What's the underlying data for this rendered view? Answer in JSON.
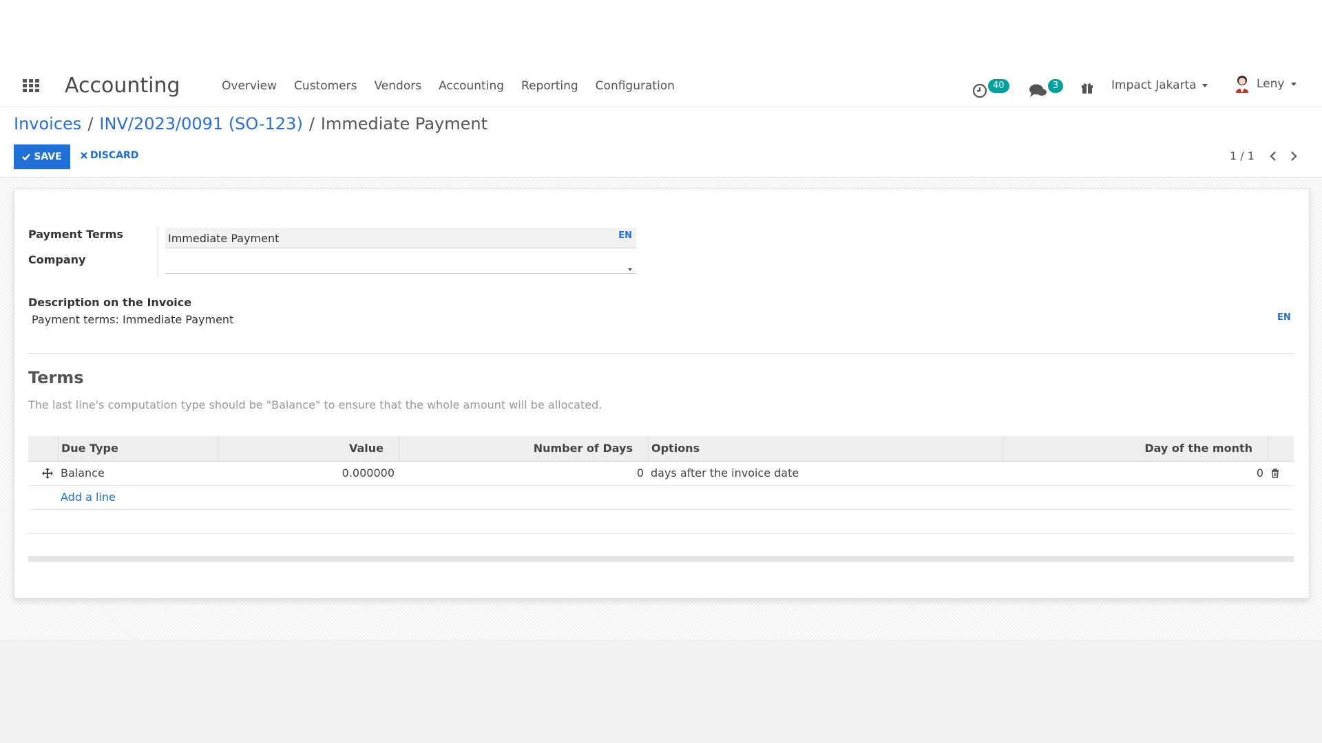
{
  "navbar": {
    "app_name": "Accounting",
    "menu": [
      "Overview",
      "Customers",
      "Vendors",
      "Accounting",
      "Reporting",
      "Configuration"
    ],
    "activity_count": "40",
    "message_count": "3",
    "company": "Impact Jakarta",
    "user": "Leny",
    "icons": [
      "apps-grid-icon",
      "clock-icon",
      "chat-icon",
      "gift-icon",
      "user-avatar-icon"
    ]
  },
  "breadcrumb": {
    "item1": "Invoices",
    "sep": "/",
    "item2": "INV/2023/0091 (SO-123)",
    "current": "Immediate Payment"
  },
  "actions": {
    "save": "SAVE",
    "discard": "DISCARD"
  },
  "pager": {
    "value": "1 / 1"
  },
  "form": {
    "payment_terms_label": "Payment Terms",
    "payment_terms_value": "Immediate Payment",
    "company_label": "Company",
    "company_value": "",
    "lang_tag": "EN",
    "description_label": "Description on the Invoice",
    "description_value": "Payment terms: Immediate Payment"
  },
  "terms": {
    "title": "Terms",
    "help": "The last line's computation type should be \"Balance\" to ensure that the whole amount will be allocated.",
    "columns": [
      "Due Type",
      "Value",
      "Number of Days",
      "Options",
      "Day of the month"
    ],
    "rows": [
      {
        "due_type": "Balance",
        "value": "0.000000",
        "days": "0",
        "options": "days after the invoice date",
        "day_of_month": "0"
      }
    ],
    "add_line": "Add a line"
  },
  "colors": {
    "accent": "#1f6fd6",
    "badge": "#00a09d"
  }
}
